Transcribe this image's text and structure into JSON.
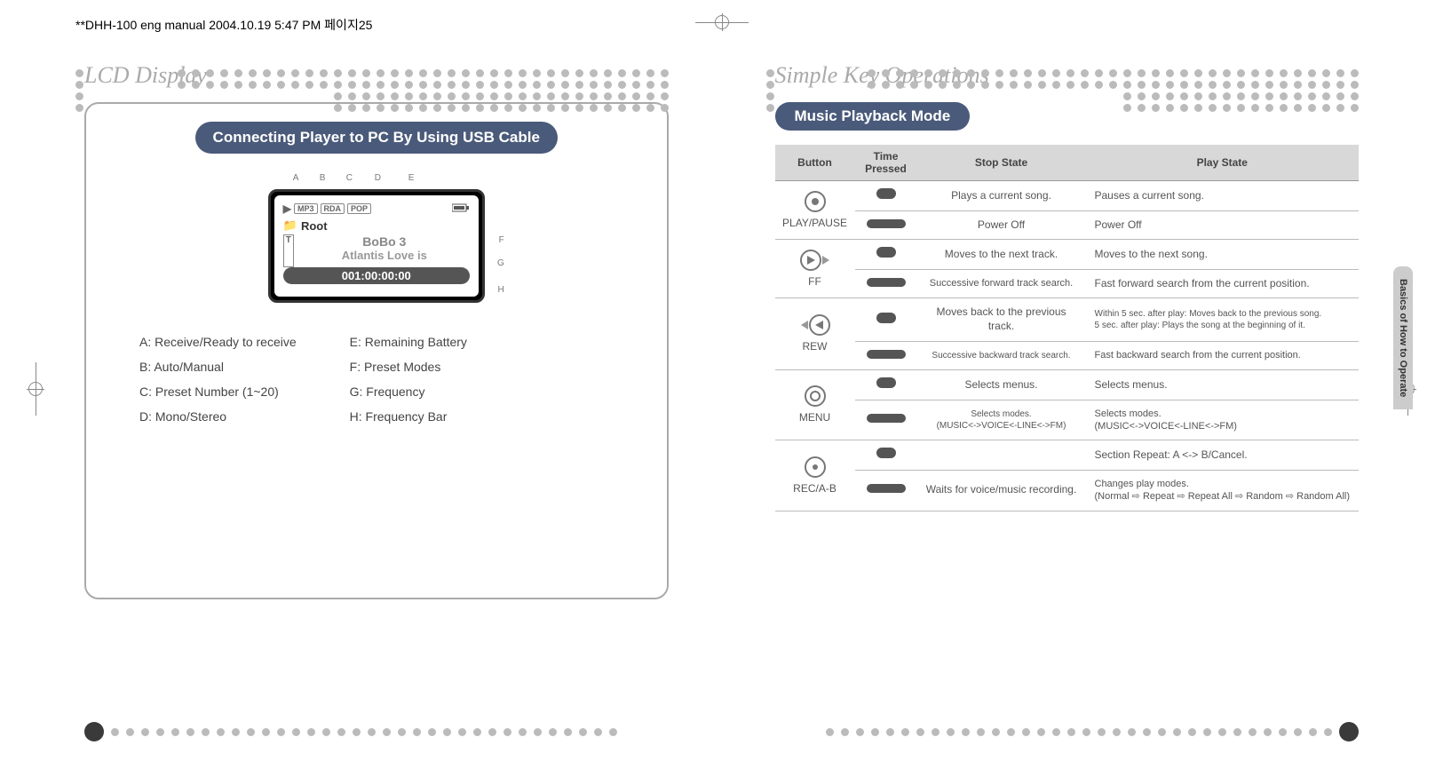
{
  "header": {
    "doc_stamp": "**DHH-100 eng manual  2004.10.19 5:47 PM  페이지25"
  },
  "left_panel": {
    "title": "LCD Display",
    "pill": "Connecting Player to PC By Using USB Cable",
    "lcd": {
      "labels_top": [
        "A",
        "B",
        "C",
        "D",
        "E"
      ],
      "labels_side": [
        "F",
        "G",
        "H"
      ],
      "tag1": "MP3",
      "tag2": "RDA",
      "tag3": "POP",
      "root": "Root",
      "line2": "BoBo 3",
      "line3": "Atlantis Love is",
      "bar": "001:00:00:00"
    },
    "legend_left": [
      "A: Receive/Ready to receive",
      "B: Auto/Manual",
      "C: Preset Number (1~20)",
      "D: Mono/Stereo"
    ],
    "legend_right": [
      "E: Remaining Battery",
      "F: Preset Modes",
      "G: Frequency",
      "H: Frequency Bar"
    ]
  },
  "right_panel": {
    "title": "Simple Key Operations",
    "pill": "Music Playback Mode",
    "side_tab": "Basics of How to Operate",
    "table": {
      "headers": {
        "button": "Button",
        "time": "Time Pressed",
        "stop": "Stop State",
        "play": "Play State"
      },
      "rows": {
        "play_pause": {
          "label": "PLAY/PAUSE",
          "short_stop": "Plays a current song.",
          "short_play": "Pauses a current song.",
          "long_stop": "Power Off",
          "long_play": "Power Off"
        },
        "ff": {
          "label": "FF",
          "short_stop": "Moves to the next track.",
          "short_play": "Moves to the next song.",
          "long_stop": "Successive forward track search.",
          "long_play": "Fast forward search from the current position."
        },
        "rew": {
          "label": "REW",
          "short_stop": "Moves back to the previous track.",
          "short_play": "Within 5 sec. after play: Moves back to the previous song.\n5 sec. after play: Plays the song at the beginning of it.",
          "long_stop": "Successive backward track search.",
          "long_play": "Fast backward search from the current position."
        },
        "menu": {
          "label": "MENU",
          "short_stop": "Selects menus.",
          "short_play": "Selects menus.",
          "long_stop": "Selects modes.\n(MUSIC<->VOICE<-LINE<->FM)",
          "long_play": "Selects modes.\n(MUSIC<->VOICE<-LINE<->FM)"
        },
        "rec": {
          "label": "REC/A-B",
          "short_stop": "",
          "short_play": "Section Repeat: A <-> B/Cancel.",
          "long_stop": "Waits for voice/music recording.",
          "long_play": "Changes play modes.\n(Normal ⇨ Repeat ⇨ Repeat All ⇨ Random ⇨ Random All)"
        }
      }
    }
  }
}
